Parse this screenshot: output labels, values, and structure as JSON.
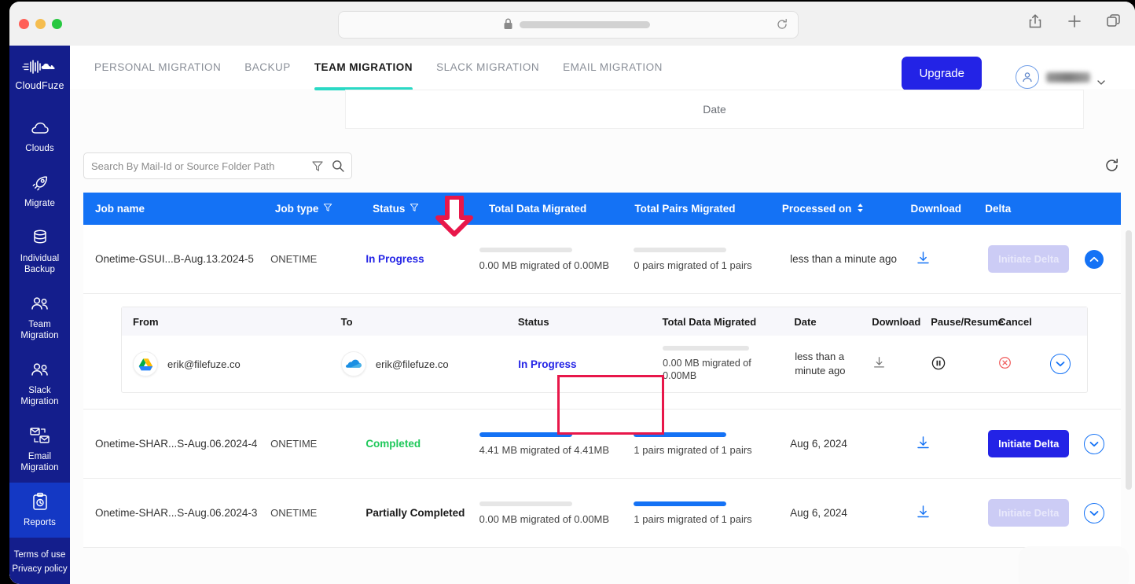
{
  "browser": {
    "traffic_lights": [
      "close",
      "minimize",
      "maximize"
    ],
    "url_value": "",
    "lock_icon": "lock-icon",
    "reload_icon": "reload-icon",
    "actions": [
      {
        "name": "share-icon",
        "label": "Share"
      },
      {
        "name": "new-tab-icon",
        "label": "New Tab"
      },
      {
        "name": "tab-overview-icon",
        "label": "Tab Overview"
      }
    ]
  },
  "sidebar": {
    "brand": "CloudFuze",
    "items": [
      {
        "label": "Clouds",
        "icon": "cloud-icon",
        "active": false
      },
      {
        "label": "Migrate",
        "icon": "rocket-icon",
        "active": false
      },
      {
        "label": "Individual Backup",
        "icon": "database-icon",
        "active": false
      },
      {
        "label": "Team Migration",
        "icon": "users-icon",
        "active": false
      },
      {
        "label": "Slack Migration",
        "icon": "users-icon",
        "active": false
      },
      {
        "label": "Email Migration",
        "icon": "mail-swap-icon",
        "active": false
      },
      {
        "label": "Reports",
        "icon": "clipboard-clock-icon",
        "active": true
      }
    ],
    "footer": {
      "terms": "Terms of use",
      "privacy": "Privacy policy"
    }
  },
  "topnav": {
    "tabs": [
      {
        "label": "PERSONAL MIGRATION",
        "active": false
      },
      {
        "label": "BACKUP",
        "active": false
      },
      {
        "label": "TEAM MIGRATION",
        "active": true
      },
      {
        "label": "SLACK MIGRATION",
        "active": false
      },
      {
        "label": "EMAIL MIGRATION",
        "active": false
      }
    ],
    "upgrade_label": "Upgrade",
    "user_name": ""
  },
  "date_panel": {
    "label": "Date"
  },
  "search": {
    "placeholder": "Search By Mail-Id or Source Folder Path",
    "value": "",
    "filter_icon": "filter-icon",
    "search_icon": "search-icon"
  },
  "refresh": {
    "icon": "refresh-icon"
  },
  "annotation": {
    "arrow": "red-down-arrow",
    "highlight_box": "red-highlight-box"
  },
  "table": {
    "columns": [
      {
        "label": "Job name",
        "filter": false,
        "sort": false
      },
      {
        "label": "Job type",
        "filter": true,
        "sort": false
      },
      {
        "label": "Status",
        "filter": true,
        "sort": false
      },
      {
        "label": "Total Data Migrated",
        "filter": false,
        "sort": false
      },
      {
        "label": "Total Pairs Migrated",
        "filter": false,
        "sort": false
      },
      {
        "label": "Processed on",
        "filter": false,
        "sort": true
      },
      {
        "label": "Download",
        "filter": false,
        "sort": false
      },
      {
        "label": "Delta",
        "filter": false,
        "sort": false
      }
    ],
    "rows": [
      {
        "job_name": "Onetime-GSUI...B-Aug.13.2024-5",
        "job_type": "ONETIME",
        "status": "In Progress",
        "status_kind": "inprogress",
        "data_progress_pct": 0,
        "data_text": "0.00 MB migrated of 0.00MB",
        "pairs_progress_pct": 0,
        "pairs_text": "0 pairs migrated of 1 pairs",
        "processed_on": "less than a minute ago",
        "download_icon": "download-icon",
        "delta_label": "Initiate Delta",
        "delta_disabled": true,
        "expanded": true
      },
      {
        "job_name": "Onetime-SHAR...S-Aug.06.2024-4",
        "job_type": "ONETIME",
        "status": "Completed",
        "status_kind": "completed",
        "data_progress_pct": 100,
        "data_text": "4.41 MB migrated of 4.41MB",
        "pairs_progress_pct": 100,
        "pairs_text": "1 pairs migrated of 1 pairs",
        "processed_on": "Aug 6, 2024",
        "download_icon": "download-icon",
        "delta_label": "Initiate Delta",
        "delta_disabled": false,
        "expanded": false
      },
      {
        "job_name": "Onetime-SHAR...S-Aug.06.2024-3",
        "job_type": "ONETIME",
        "status": "Partially Completed",
        "status_kind": "partial",
        "data_progress_pct": 0,
        "data_text": "0.00 MB migrated of 0.00MB",
        "pairs_progress_pct": 100,
        "pairs_text": "1 pairs migrated of 1 pairs",
        "processed_on": "Aug 6, 2024",
        "download_icon": "download-icon",
        "delta_label": "Initiate Delta",
        "delta_disabled": true,
        "expanded": false
      }
    ]
  },
  "subtable": {
    "columns": [
      {
        "label": "From"
      },
      {
        "label": "To"
      },
      {
        "label": "Status"
      },
      {
        "label": "Total Data Migrated"
      },
      {
        "label": "Date"
      },
      {
        "label": "Download"
      },
      {
        "label": "Pause/Resume"
      },
      {
        "label": "Cancel"
      }
    ],
    "rows": [
      {
        "from_account": "erik@filefuze.co",
        "from_icon": "google-drive-icon",
        "to_account": "erik@filefuze.co",
        "to_icon": "onedrive-icon",
        "status": "In Progress",
        "data_progress_pct": 0,
        "data_text": "0.00 MB migrated of 0.00MB",
        "date": "less than a minute ago",
        "download_icon": "download-icon",
        "pause_icon": "pause-icon",
        "cancel_icon": "cancel-icon",
        "expand_icon": "chevron-down-icon"
      }
    ]
  },
  "colors": {
    "sidebar_bg": "#141e8c",
    "sidebar_active": "#1438c4",
    "header_blue": "#1472f5",
    "accent_teal": "#2ad9c5",
    "primary_blue": "#2323e6",
    "status_inprogress": "#2323e6",
    "status_completed": "#1ec85a",
    "annotation_red": "#e8174a"
  }
}
